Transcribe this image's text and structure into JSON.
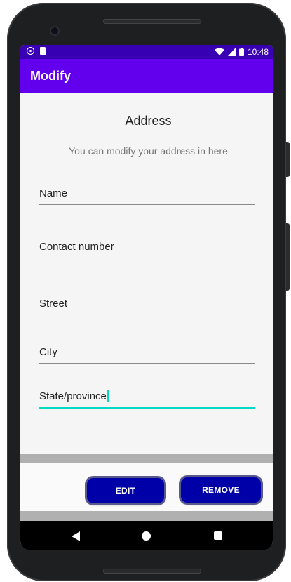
{
  "status_bar": {
    "time": "10:48",
    "icons": [
      "circle-notification-icon",
      "sim-card-icon",
      "wifi-icon",
      "signal-icon",
      "battery-icon"
    ]
  },
  "app_bar": {
    "title": "Modify"
  },
  "form": {
    "heading": "Address",
    "subheading": "You can modify your address in here",
    "fields": [
      {
        "value": "Name"
      },
      {
        "value": "Contact number"
      },
      {
        "value": "Street"
      },
      {
        "value": "City"
      },
      {
        "value": "State/province"
      }
    ]
  },
  "actions": {
    "edit_label": "EDIT",
    "remove_label": "REMOVE"
  },
  "colors": {
    "status_bar": "#3700b3",
    "app_bar": "#6200ee",
    "accent": "#03dac5",
    "button": "#0000a8"
  }
}
